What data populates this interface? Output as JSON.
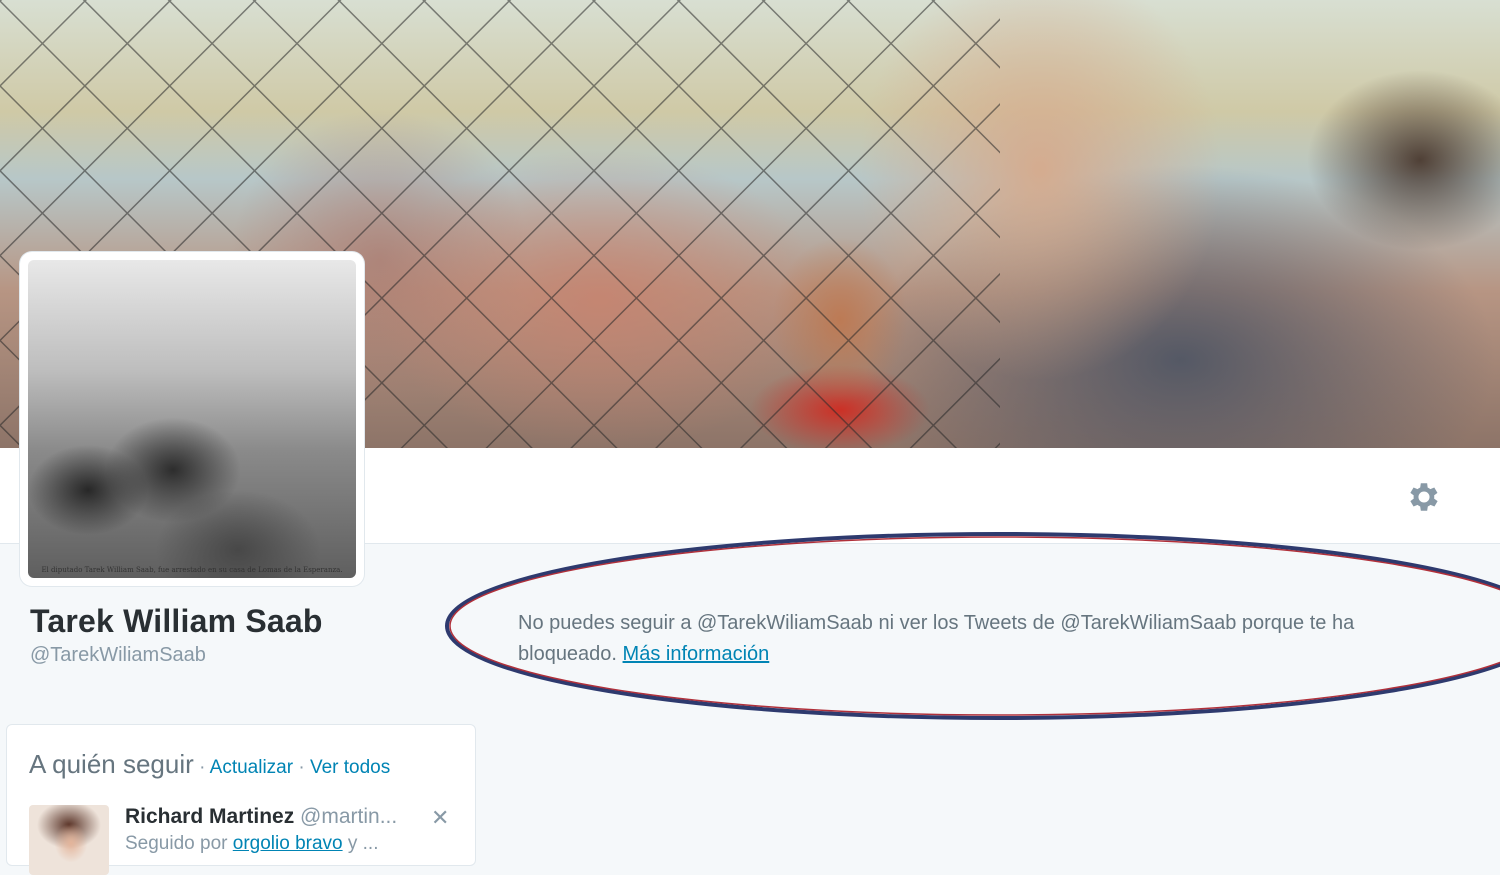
{
  "profile": {
    "name": "Tarek William Saab",
    "handle": "@TarekWiliamSaab",
    "avatar_caption": "El diputado Tarek William Saab, fue arrestado en su casa de Lomas de la Esperanza."
  },
  "blocked_notice": {
    "message": "No puedes seguir a @TarekWiliamSaab ni ver los Tweets de @TarekWiliamSaab porque te ha bloqueado.",
    "link_label": "Más información"
  },
  "settings": {
    "icon": "gear-icon"
  },
  "who_to_follow": {
    "title": "A quién seguir",
    "sep1": " · ",
    "refresh_label": "Actualizar",
    "sep2": " · ",
    "view_all_label": "Ver todos",
    "suggestion": {
      "name": "Richard Martinez",
      "handle": "@martin...",
      "followed_by_prefix": "Seguido por",
      "followed_by_user": "orgolio bravo",
      "followed_by_suffix": "y ...",
      "dismiss_icon": "close-icon"
    }
  },
  "colors": {
    "link": "#0084b4",
    "muted": "#66757f",
    "oval_stroke": "#2e3a6e",
    "oval_inner": "#b0303a"
  }
}
